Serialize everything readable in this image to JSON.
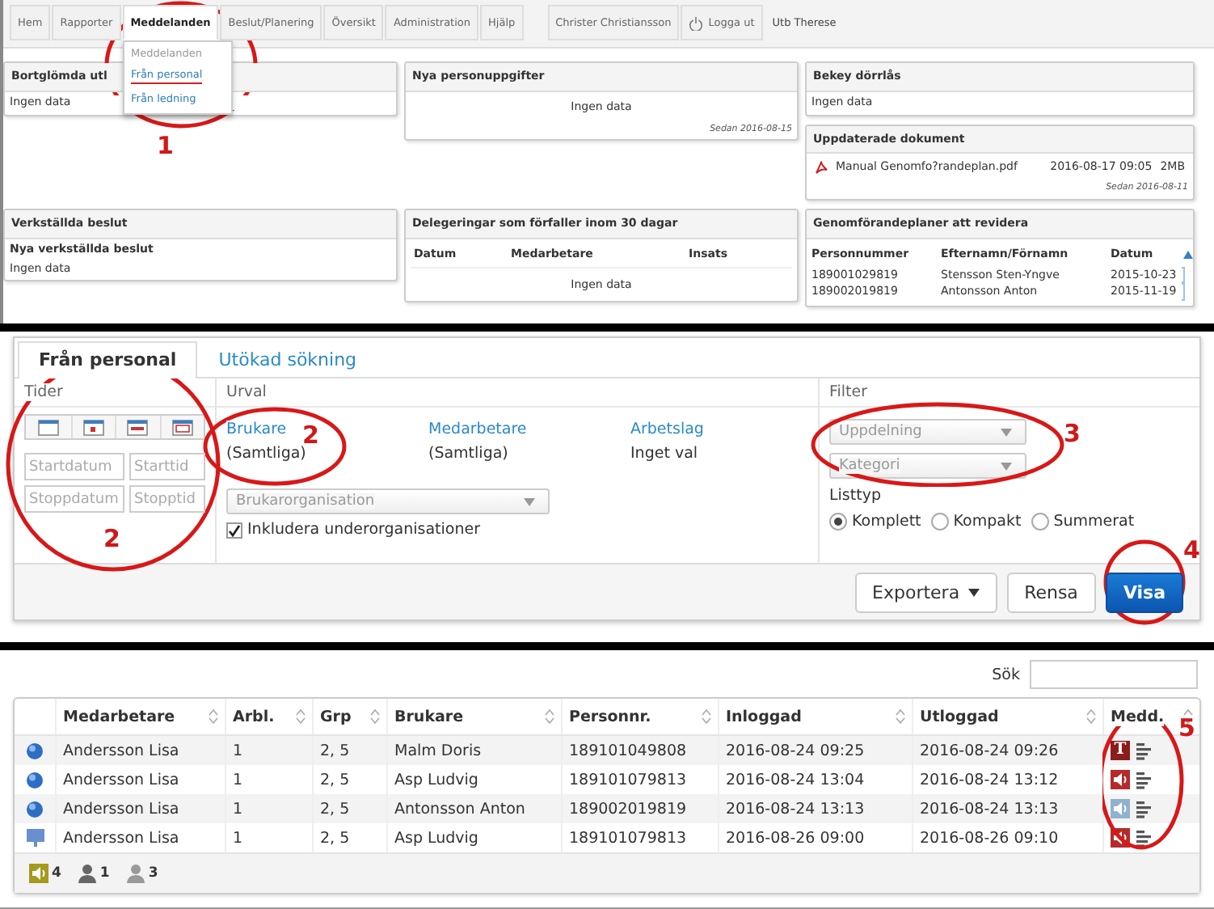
{
  "top": {
    "nav": {
      "tabs": [
        {
          "label": "Hem",
          "selected": false
        },
        {
          "label": "Rapporter",
          "selected": false
        },
        {
          "label": "Meddelanden",
          "selected": true
        },
        {
          "label": "Beslut/Planering",
          "selected": false
        },
        {
          "label": "Översikt",
          "selected": false
        },
        {
          "label": "Administration",
          "selected": false
        },
        {
          "label": "Hjälp",
          "selected": false
        }
      ],
      "user": "Christer Christiansson",
      "logout": "Logga ut",
      "unit": "Utb Therese"
    },
    "menu": {
      "header": "Meddelanden",
      "items": [
        {
          "label": "Från personal",
          "selected": true
        },
        {
          "label": "Från ledning",
          "selected": false
        }
      ]
    },
    "rows": [
      {
        "cells": [
          [
            {
              "title": "Bortglömda utl",
              "body": [
                {
                  "kind": "text",
                  "text": "Ingen data"
                }
              ]
            }
          ],
          [
            {
              "title": "Nya personuppgifter",
              "body": [
                {
                  "kind": "centered",
                  "text": "Ingen data"
                },
                {
                  "kind": "note",
                  "text": "Sedan 2016-08-15"
                }
              ]
            }
          ],
          [
            {
              "title": "Bekey dörrlås",
              "body": [
                {
                  "kind": "text",
                  "text": "Ingen data"
                }
              ]
            },
            {
              "title": "Uppdaterade dokument",
              "body": [
                {
                  "kind": "file",
                  "name": "Manual Genomfo?randeplan.pdf",
                  "date": "2016-08-17 09:05",
                  "size": "2MB"
                },
                {
                  "kind": "note",
                  "text": "Sedan 2016-08-11"
                }
              ]
            }
          ]
        ]
      },
      {
        "cells": [
          [
            {
              "title": "Verkställda beslut",
              "body": [
                {
                  "kind": "subheading",
                  "text": "Nya verkställda beslut"
                },
                {
                  "kind": "text",
                  "text": "Ingen data"
                }
              ]
            }
          ],
          [
            {
              "title": "Delegeringar som förfaller inom 30 dagar",
              "body": [
                {
                  "kind": "header_row",
                  "columns": [
                    "Datum",
                    "Medarbetare",
                    "Insats"
                  ]
                },
                {
                  "kind": "centered",
                  "text": "Ingen data"
                }
              ]
            }
          ],
          [
            {
              "title": "Genomförandeplaner att revidera",
              "body": [
                {
                  "kind": "table",
                  "columns": [
                    "Personnummer",
                    "Efternamn/Förnamn",
                    "Datum"
                  ],
                  "rows": [
                    [
                      "189001029819",
                      "Stensson Sten-Yngve",
                      "2015-10-23"
                    ],
                    [
                      "189002019819",
                      "Antonsson Anton",
                      "2015-11-19"
                    ]
                  ]
                }
              ]
            }
          ]
        ]
      }
    ]
  },
  "search": {
    "tabs": [
      {
        "label": "Från personal",
        "selected": true
      },
      {
        "label": "Utökad sökning",
        "selected": false
      }
    ],
    "times": {
      "title": "Tider",
      "fields": [
        {
          "placeholder": "Startdatum"
        },
        {
          "placeholder": "Starttid"
        },
        {
          "placeholder": "Stoppdatum"
        },
        {
          "placeholder": "Stopptid"
        }
      ]
    },
    "selection": {
      "title": "Urval",
      "groups": [
        {
          "link": "Brukare",
          "value": "(Samtliga)"
        },
        {
          "link": "Medarbetare",
          "value": "(Samtliga)"
        },
        {
          "link": "Arbetslag",
          "value": "Inget val"
        }
      ],
      "org_select": {
        "placeholder": "Brukarorganisation"
      },
      "include_sub": {
        "label": "Inkludera underorganisationer",
        "checked": true
      }
    },
    "filter": {
      "title": "Filter",
      "selects": [
        {
          "placeholder": "Uppdelning"
        },
        {
          "placeholder": "Kategori"
        }
      ],
      "list_type": {
        "label": "Listtyp",
        "options": [
          {
            "label": "Komplett",
            "selected": true
          },
          {
            "label": "Kompakt",
            "selected": false
          },
          {
            "label": "Summerat",
            "selected": false
          }
        ]
      }
    },
    "buttons": [
      {
        "label": "Exportera",
        "kind": "dropdown"
      },
      {
        "label": "Rensa",
        "kind": "default"
      },
      {
        "label": "Visa",
        "kind": "primary"
      }
    ]
  },
  "results": {
    "search_label": "Sök",
    "columns": [
      "Medarbetare",
      "Arbl.",
      "Grp",
      "Brukare",
      "Personnr.",
      "Inloggad",
      "Utloggad",
      "Medd."
    ],
    "rows": [
      {
        "status": {
          "kind": "circle"
        },
        "cells": [
          "Andersson Lisa",
          "1",
          "2, 5",
          "Malm Doris",
          "189101049808",
          "2016-08-24 09:25",
          "2016-08-24 09:26"
        ],
        "message": {
          "kind": "text",
          "glyph": "T",
          "color": "#8c1d1d"
        }
      },
      {
        "status": {
          "kind": "circle"
        },
        "cells": [
          "Andersson Lisa",
          "1",
          "2, 5",
          "Asp Ludvig",
          "189101079813",
          "2016-08-24 13:04",
          "2016-08-24 13:12"
        ],
        "message": {
          "kind": "audio",
          "color": "#b52a2a"
        }
      },
      {
        "status": {
          "kind": "circle"
        },
        "cells": [
          "Andersson Lisa",
          "1",
          "2, 5",
          "Antonsson Anton",
          "189002019819",
          "2016-08-24 13:13",
          "2016-08-24 13:13"
        ],
        "message": {
          "kind": "audio",
          "color": "#8fb3cf"
        }
      },
      {
        "status": {
          "kind": "monitor"
        },
        "cells": [
          "Andersson Lisa",
          "1",
          "2, 5",
          "Asp Ludvig",
          "189101079813",
          "2016-08-26 09:00",
          "2016-08-26 09:10"
        ],
        "message": {
          "kind": "audio",
          "color": "#b52a2a"
        }
      }
    ],
    "legend": [
      {
        "kind": "audio",
        "count": "4"
      },
      {
        "kind": "person",
        "count": "1"
      },
      {
        "kind": "person_faded",
        "count": "3"
      }
    ]
  },
  "annotations": [
    {
      "label": "1"
    },
    {
      "label": "2"
    },
    {
      "label": "2"
    },
    {
      "label": "3"
    },
    {
      "label": "4"
    },
    {
      "label": "5"
    }
  ]
}
